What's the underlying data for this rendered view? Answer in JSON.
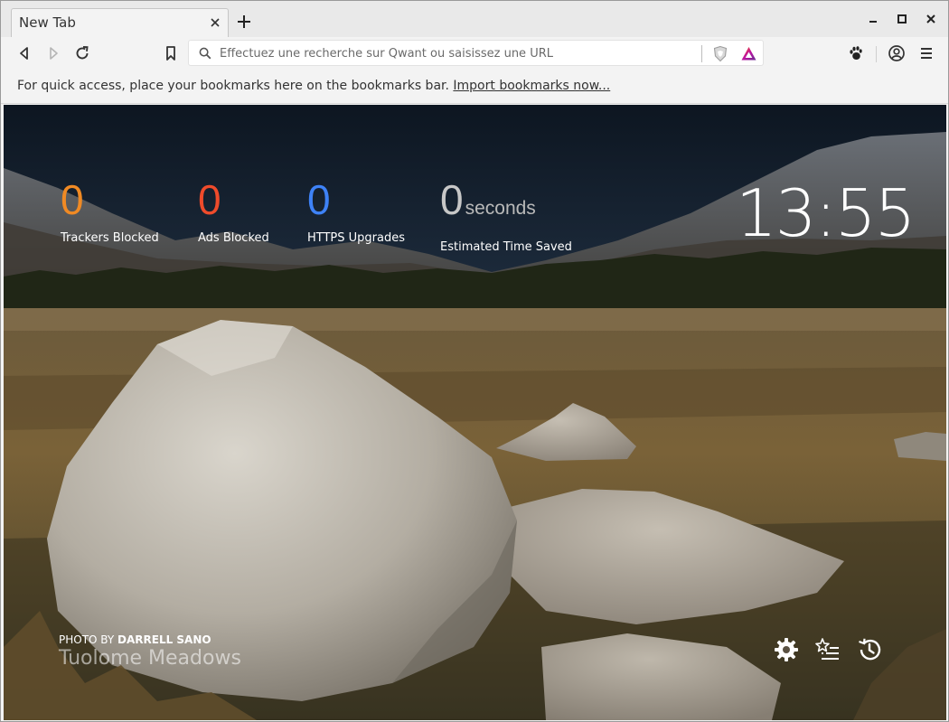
{
  "window": {
    "tab_title": "New Tab"
  },
  "toolbar": {
    "url_placeholder": "Effectuez une recherche sur Qwant ou saisissez une URL"
  },
  "bookmarks_bar": {
    "message": "For quick access, place your bookmarks here on the bookmarks bar.",
    "import_link": "Import bookmarks now..."
  },
  "ntp": {
    "stats": [
      {
        "value": "0",
        "label": "Trackers Blocked",
        "color": "#f08a24"
      },
      {
        "value": "0",
        "label": "Ads Blocked",
        "color": "#ef4b2b"
      },
      {
        "value": "0",
        "label": "HTTPS Upgrades",
        "color": "#3e82f7"
      },
      {
        "value": "0",
        "unit": "seconds",
        "label": "Estimated Time Saved",
        "color": "#c7c7c7"
      }
    ],
    "clock": "13:55",
    "photo_by_prefix": "PHOTO BY ",
    "photographer": "DARRELL SANO",
    "location": "Tuolome Meadows"
  },
  "icons": {
    "back": "back-arrow-icon",
    "forward": "forward-arrow-icon",
    "reload": "reload-icon",
    "bookmark": "bookmark-icon",
    "search": "search-icon",
    "brave_shields": "brave-shield-icon",
    "brave_rewards": "brave-rewards-triangle-icon",
    "extension": "paw-icon",
    "profile": "profile-icon",
    "menu": "hamburger-menu-icon",
    "settings": "gear-icon",
    "bookmarks_ntp": "bookmarks-star-list-icon",
    "history": "history-clock-icon"
  }
}
